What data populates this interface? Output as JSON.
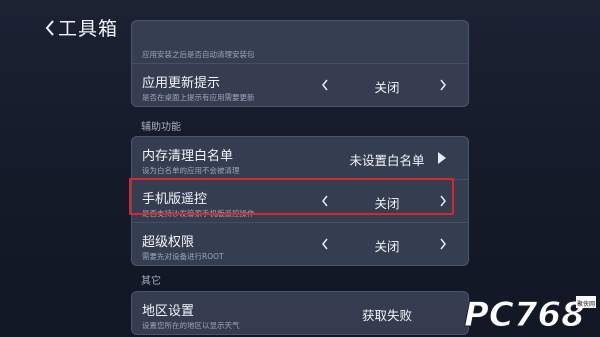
{
  "header": {
    "title": "工具箱"
  },
  "top_card": {
    "rows": [
      {
        "label": "",
        "sub": "应用安装之后是否自动清理安装包",
        "value": ""
      },
      {
        "label": "应用更新提示",
        "sub": "是否在桌面上提示有应用需要更新",
        "value": "关闭"
      }
    ]
  },
  "section_helper": {
    "title": "辅助功能",
    "rows": [
      {
        "label": "内存清理白名单",
        "sub": "设为白名单的应用不会被清理",
        "value": "未设置白名单"
      },
      {
        "label": "手机版遥控",
        "sub": "是否支持沙发管家手机版遥控操作",
        "value": "关闭"
      },
      {
        "label": "超级权限",
        "sub": "需要先对设备进行ROOT",
        "value": "关闭"
      }
    ]
  },
  "section_other": {
    "title": "其它",
    "rows": [
      {
        "label": "地区设置",
        "sub": "设置您所在的地区以显示天气",
        "value": "获取失败"
      }
    ]
  },
  "watermark": {
    "text": "PC768",
    "suffix": "聚侠网"
  },
  "colors": {
    "highlight": "#d8262e",
    "card": "#3a4256",
    "background": "#161c2a"
  }
}
